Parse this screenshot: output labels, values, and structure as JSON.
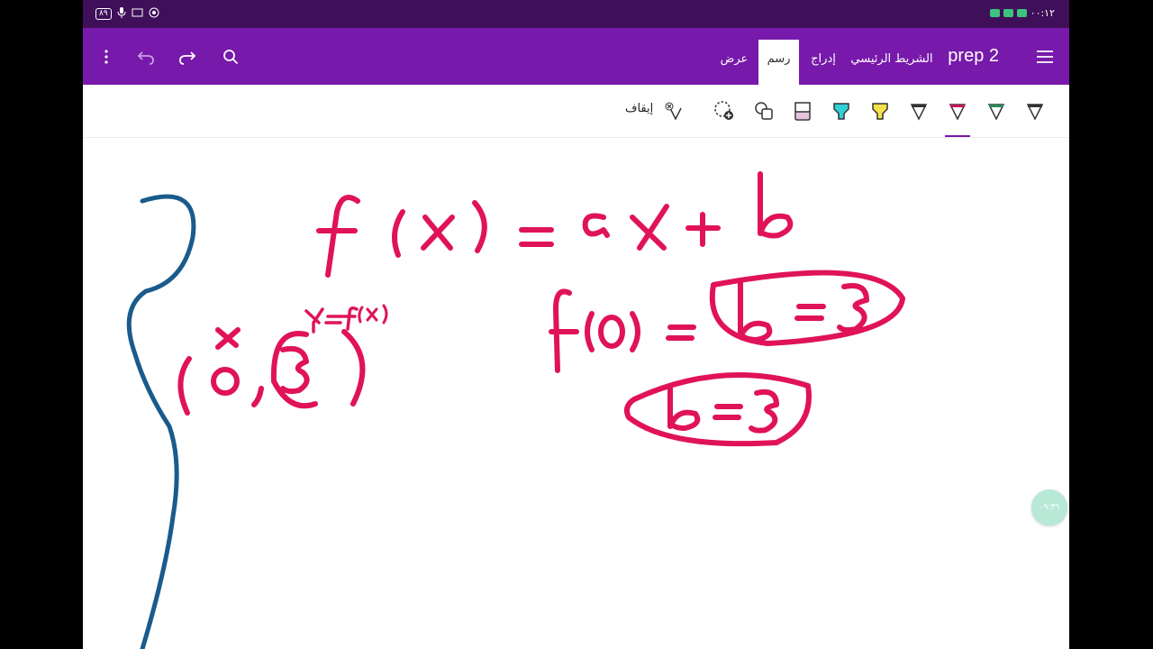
{
  "status_bar": {
    "battery": "٨٩",
    "time": "٠٠:١٢"
  },
  "app_bar": {
    "title": "prep 2",
    "tabs": [
      {
        "label": "الشريط الرئيسي",
        "active": false
      },
      {
        "label": "إدراج",
        "active": false
      },
      {
        "label": "رسم",
        "active": true
      },
      {
        "label": "عرض",
        "active": false
      }
    ]
  },
  "toolbar": {
    "stop_label": "إيقاف",
    "pen_colors": [
      "#333333",
      "#2e8b57",
      "#c2185b",
      "#333333",
      "#f5e14a",
      "#31d0d6",
      "#e6c3dc"
    ]
  },
  "canvas": {
    "ink_color": "#e0135a",
    "bracket_color": "#1a5b8c",
    "ink_lines": [
      "f(x) = ax+b",
      "f(0) = b = 3",
      "b = 3",
      "(0 , 3)",
      "x",
      "y = f(x)"
    ]
  },
  "fab": {
    "label": "٠٩:٣٦"
  }
}
